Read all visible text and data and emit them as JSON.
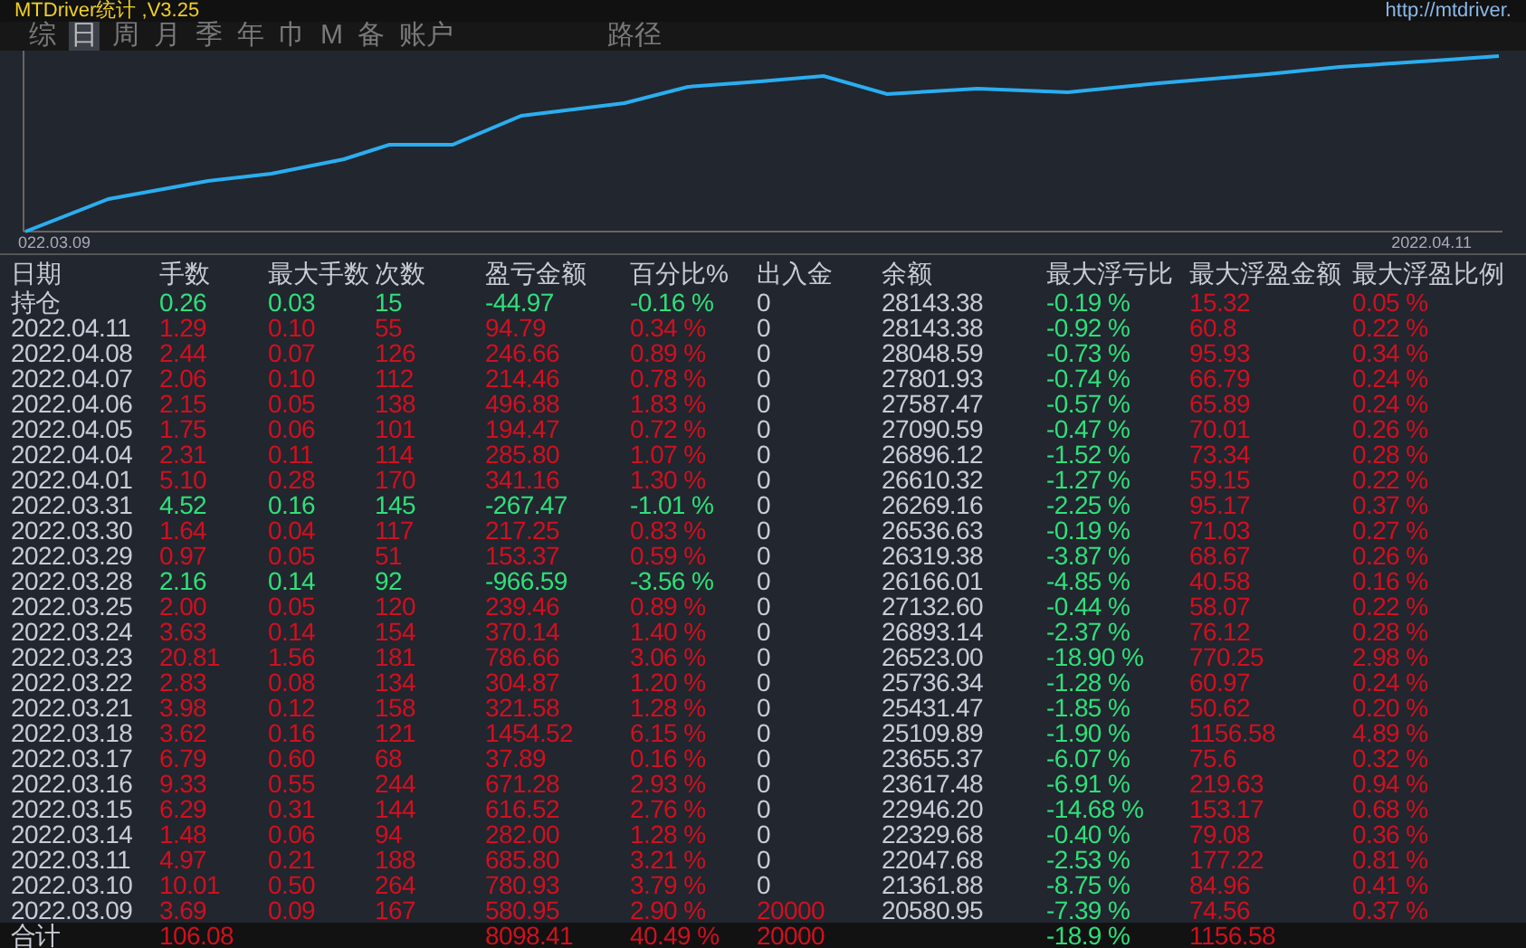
{
  "window": {
    "title": "MTDriver统计 ,V3.25",
    "url": "http://mtdriver."
  },
  "tabs": [
    {
      "label": "综",
      "selected": false
    },
    {
      "label": "日",
      "selected": true
    },
    {
      "label": "周",
      "selected": false
    },
    {
      "label": "月",
      "selected": false
    },
    {
      "label": "季",
      "selected": false
    },
    {
      "label": "年",
      "selected": false
    },
    {
      "label": "巾",
      "selected": false
    },
    {
      "label": "M",
      "selected": false
    },
    {
      "label": "备",
      "selected": false
    },
    {
      "label": "账户",
      "selected": false
    }
  ],
  "path_button": "路径",
  "chart": {
    "start_label": "022.03.09",
    "end_label": "2022.04.11"
  },
  "table": {
    "columns": [
      "日期",
      "手数",
      "最大手数",
      "次数",
      "盈亏金额",
      "百分比%",
      "出入金",
      "余额",
      "最大浮亏比",
      "最大浮盈金额",
      "最大浮盈比例"
    ],
    "rows": [
      {
        "kind": "loss",
        "deposit": false,
        "cells": [
          "持仓",
          "0.26",
          "0.03",
          "15",
          "-44.97",
          "-0.16 %",
          "0",
          "28143.38",
          "-0.19 %",
          "15.32",
          "0.05 %"
        ]
      },
      {
        "kind": "profit",
        "deposit": false,
        "cells": [
          "2022.04.11",
          "1.29",
          "0.10",
          "55",
          "94.79",
          "0.34 %",
          "0",
          "28143.38",
          "-0.92 %",
          "60.8",
          "0.22 %"
        ]
      },
      {
        "kind": "profit",
        "deposit": false,
        "cells": [
          "2022.04.08",
          "2.44",
          "0.07",
          "126",
          "246.66",
          "0.89 %",
          "0",
          "28048.59",
          "-0.73 %",
          "95.93",
          "0.34 %"
        ]
      },
      {
        "kind": "profit",
        "deposit": false,
        "cells": [
          "2022.04.07",
          "2.06",
          "0.10",
          "112",
          "214.46",
          "0.78 %",
          "0",
          "27801.93",
          "-0.74 %",
          "66.79",
          "0.24 %"
        ]
      },
      {
        "kind": "profit",
        "deposit": false,
        "cells": [
          "2022.04.06",
          "2.15",
          "0.05",
          "138",
          "496.88",
          "1.83 %",
          "0",
          "27587.47",
          "-0.57 %",
          "65.89",
          "0.24 %"
        ]
      },
      {
        "kind": "profit",
        "deposit": false,
        "cells": [
          "2022.04.05",
          "1.75",
          "0.06",
          "101",
          "194.47",
          "0.72 %",
          "0",
          "27090.59",
          "-0.47 %",
          "70.01",
          "0.26 %"
        ]
      },
      {
        "kind": "profit",
        "deposit": false,
        "cells": [
          "2022.04.04",
          "2.31",
          "0.11",
          "114",
          "285.80",
          "1.07 %",
          "0",
          "26896.12",
          "-1.52 %",
          "73.34",
          "0.28 %"
        ]
      },
      {
        "kind": "profit",
        "deposit": false,
        "cells": [
          "2022.04.01",
          "5.10",
          "0.28",
          "170",
          "341.16",
          "1.30 %",
          "0",
          "26610.32",
          "-1.27 %",
          "59.15",
          "0.22 %"
        ]
      },
      {
        "kind": "loss",
        "deposit": false,
        "cells": [
          "2022.03.31",
          "4.52",
          "0.16",
          "145",
          "-267.47",
          "-1.01 %",
          "0",
          "26269.16",
          "-2.25 %",
          "95.17",
          "0.37 %"
        ]
      },
      {
        "kind": "profit",
        "deposit": false,
        "cells": [
          "2022.03.30",
          "1.64",
          "0.04",
          "117",
          "217.25",
          "0.83 %",
          "0",
          "26536.63",
          "-0.19 %",
          "71.03",
          "0.27 %"
        ]
      },
      {
        "kind": "profit",
        "deposit": false,
        "cells": [
          "2022.03.29",
          "0.97",
          "0.05",
          "51",
          "153.37",
          "0.59 %",
          "0",
          "26319.38",
          "-3.87 %",
          "68.67",
          "0.26 %"
        ]
      },
      {
        "kind": "loss",
        "deposit": false,
        "cells": [
          "2022.03.28",
          "2.16",
          "0.14",
          "92",
          "-966.59",
          "-3.56 %",
          "0",
          "26166.01",
          "-4.85 %",
          "40.58",
          "0.16 %"
        ]
      },
      {
        "kind": "profit",
        "deposit": false,
        "cells": [
          "2022.03.25",
          "2.00",
          "0.05",
          "120",
          "239.46",
          "0.89 %",
          "0",
          "27132.60",
          "-0.44 %",
          "58.07",
          "0.22 %"
        ]
      },
      {
        "kind": "profit",
        "deposit": false,
        "cells": [
          "2022.03.24",
          "3.63",
          "0.14",
          "154",
          "370.14",
          "1.40 %",
          "0",
          "26893.14",
          "-2.37 %",
          "76.12",
          "0.28 %"
        ]
      },
      {
        "kind": "profit",
        "deposit": false,
        "cells": [
          "2022.03.23",
          "20.81",
          "1.56",
          "181",
          "786.66",
          "3.06 %",
          "0",
          "26523.00",
          "-18.90 %",
          "770.25",
          "2.98 %"
        ]
      },
      {
        "kind": "profit",
        "deposit": false,
        "cells": [
          "2022.03.22",
          "2.83",
          "0.08",
          "134",
          "304.87",
          "1.20 %",
          "0",
          "25736.34",
          "-1.28 %",
          "60.97",
          "0.24 %"
        ]
      },
      {
        "kind": "profit",
        "deposit": false,
        "cells": [
          "2022.03.21",
          "3.98",
          "0.12",
          "158",
          "321.58",
          "1.28 %",
          "0",
          "25431.47",
          "-1.85 %",
          "50.62",
          "0.20 %"
        ]
      },
      {
        "kind": "profit",
        "deposit": false,
        "cells": [
          "2022.03.18",
          "3.62",
          "0.16",
          "121",
          "1454.52",
          "6.15 %",
          "0",
          "25109.89",
          "-1.90 %",
          "1156.58",
          "4.89 %"
        ]
      },
      {
        "kind": "profit",
        "deposit": false,
        "cells": [
          "2022.03.17",
          "6.79",
          "0.60",
          "68",
          "37.89",
          "0.16 %",
          "0",
          "23655.37",
          "-6.07 %",
          "75.6",
          "0.32 %"
        ]
      },
      {
        "kind": "profit",
        "deposit": false,
        "cells": [
          "2022.03.16",
          "9.33",
          "0.55",
          "244",
          "671.28",
          "2.93 %",
          "0",
          "23617.48",
          "-6.91 %",
          "219.63",
          "0.94 %"
        ]
      },
      {
        "kind": "profit",
        "deposit": false,
        "cells": [
          "2022.03.15",
          "6.29",
          "0.31",
          "144",
          "616.52",
          "2.76 %",
          "0",
          "22946.20",
          "-14.68 %",
          "153.17",
          "0.68 %"
        ]
      },
      {
        "kind": "profit",
        "deposit": false,
        "cells": [
          "2022.03.14",
          "1.48",
          "0.06",
          "94",
          "282.00",
          "1.28 %",
          "0",
          "22329.68",
          "-0.40 %",
          "79.08",
          "0.36 %"
        ]
      },
      {
        "kind": "profit",
        "deposit": false,
        "cells": [
          "2022.03.11",
          "4.97",
          "0.21",
          "188",
          "685.80",
          "3.21 %",
          "0",
          "22047.68",
          "-2.53 %",
          "177.22",
          "0.81 %"
        ]
      },
      {
        "kind": "profit",
        "deposit": false,
        "cells": [
          "2022.03.10",
          "10.01",
          "0.50",
          "264",
          "780.93",
          "3.79 %",
          "0",
          "21361.88",
          "-8.75 %",
          "84.96",
          "0.41 %"
        ]
      },
      {
        "kind": "profit",
        "deposit": true,
        "cells": [
          "2022.03.09",
          "3.69",
          "0.09",
          "167",
          "580.95",
          "2.90 %",
          "20000",
          "20580.95",
          "-7.39 %",
          "74.56",
          "0.37 %"
        ]
      }
    ],
    "total": {
      "kind": "profit",
      "deposit": true,
      "cells": [
        "合计",
        "106.08",
        "",
        "",
        "8098.41",
        "40.49 %",
        "20000",
        "",
        "-18.9 %",
        "1156.58",
        ""
      ]
    }
  }
}
